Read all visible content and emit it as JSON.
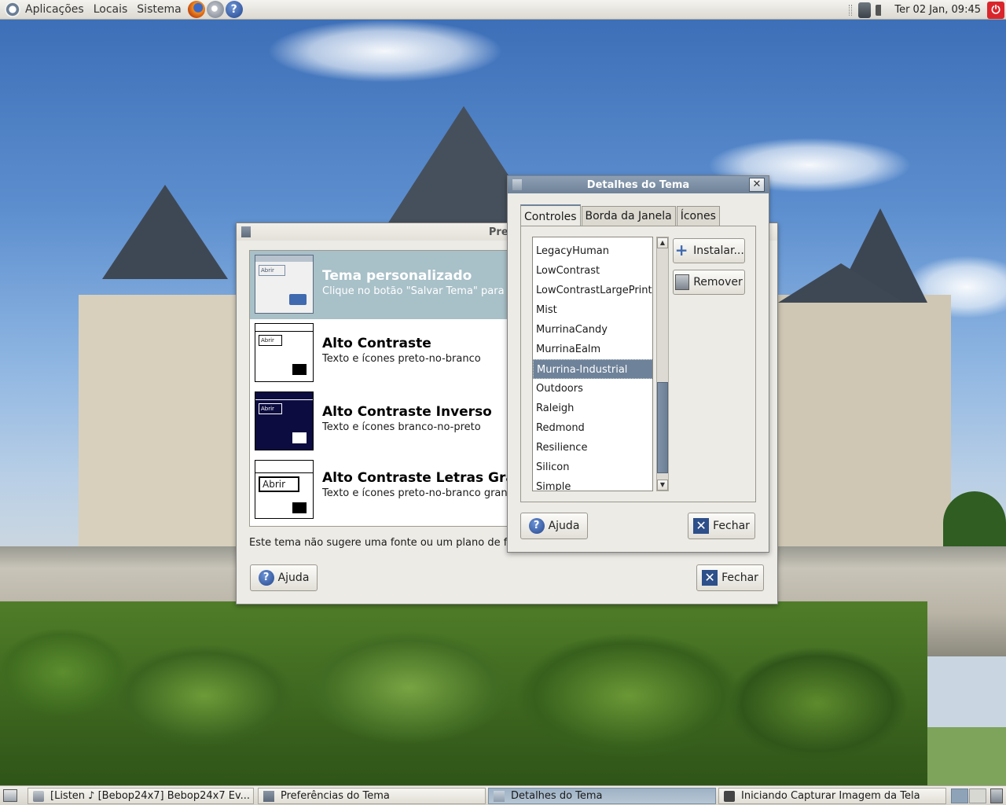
{
  "top_panel": {
    "menus": [
      "Aplicações",
      "Locais",
      "Sistema"
    ],
    "clock": "Ter 02 Jan, 09:45",
    "icons": [
      "ubuntu-logo-icon",
      "firefox-icon",
      "evolution-icon",
      "help-icon",
      "trash-icon",
      "volume-icon",
      "power-icon"
    ]
  },
  "back_window": {
    "title": "Preferências d",
    "themes": [
      {
        "name": "Tema personalizado",
        "desc": "Clique no botão \"Salvar Tema\" para s"
      },
      {
        "name": "Alto Contraste",
        "desc": "Texto e ícones preto-no-branco"
      },
      {
        "name": "Alto Contraste Inverso",
        "desc": "Texto e ícones branco-no-preto"
      },
      {
        "name": "Alto Contraste Letras Gran",
        "desc": "Texto e ícones preto-no-branco grand"
      }
    ],
    "thumb_label": "Abrir",
    "footer_text": "Este tema não sugere uma fonte ou um plano de fu",
    "help_label": "Ajuda",
    "close_label": "Fechar"
  },
  "details_window": {
    "title": "Detalhes do Tema",
    "tabs": [
      "Controles",
      "Borda da Janela",
      "Ícones"
    ],
    "active_tab": "Controles",
    "items": [
      "LegacyHuman",
      "LowContrast",
      "LowContrastLargePrint",
      "Mist",
      "MurrinaCandy",
      "MurrinaEalm",
      "Murrina-Industrial",
      "Outdoors",
      "Raleigh",
      "Redmond",
      "Resilience",
      "Silicon",
      "Simple"
    ],
    "selected_item": "Murrina-Industrial",
    "install_label": "Instalar...",
    "remove_label": "Remover",
    "help_label": "Ajuda",
    "close_label": "Fechar"
  },
  "taskbar": {
    "tasks": [
      "[Listen ♪ [Bebop24x7] Bebop24x7 Ev...",
      "Preferências do Tema",
      "Detalhes do Tema",
      "Iniciando Capturar Imagem da Tela"
    ],
    "active_task": "Detalhes do Tema"
  },
  "colors": {
    "selection": "#6e8299",
    "theme_selected_row": "#a8c0c8",
    "panel": "#dcd9d1"
  }
}
